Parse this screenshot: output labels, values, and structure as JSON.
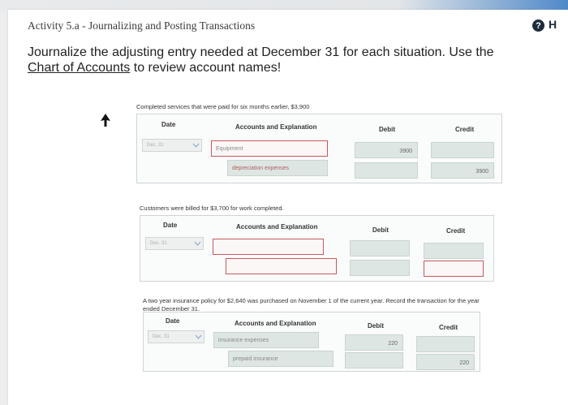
{
  "header": {
    "activity_title": "Activity 5.a - Journalizing and Posting Transactions",
    "instruction_text": "Journalize the adjusting entry needed at December 31 for each situation. Use the ",
    "instruction_link": "Chart of Accounts",
    "instruction_end": " to review account names!",
    "help_letter": "H"
  },
  "columns": {
    "date": "Date",
    "accounts": "Accounts and Explanation",
    "debit": "Debit",
    "credit": "Credit"
  },
  "situations": [
    {
      "description": "Completed services that were paid for six months earlier, $3,900",
      "date": "Dec. 31",
      "rows": [
        {
          "account": "Equipment",
          "debit": "3900",
          "credit": ""
        },
        {
          "account": "depreciation expenses",
          "debit": "",
          "credit": "3900"
        }
      ]
    },
    {
      "description": "Customers were billed for $3,700 for work completed.",
      "date": "Dec. 31",
      "rows": [
        {
          "account": "",
          "debit": "",
          "credit": ""
        },
        {
          "account": "",
          "debit": "",
          "credit": ""
        }
      ]
    },
    {
      "description": "A two year insurance policy for $2,640 was purchased on November 1 of the current year. Record the transaction for the year ended December 31.",
      "date": "Dec. 31",
      "rows": [
        {
          "account": "insurance expenses",
          "debit": "220",
          "credit": ""
        },
        {
          "account": "prepaid insurance",
          "debit": "",
          "credit": "220"
        }
      ]
    }
  ]
}
